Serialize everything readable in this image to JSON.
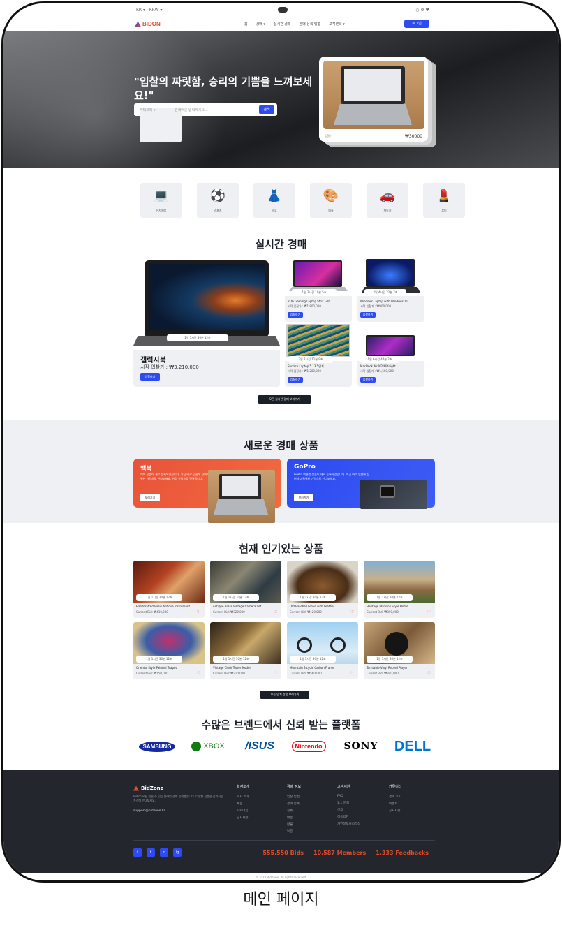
{
  "topbar": {
    "left": "KR ▾  ·  KRW ▾",
    "right": "○  ⚙  ♥"
  },
  "nav": {
    "logo": "BIDON",
    "menu": [
      "홈",
      "경매 ▾",
      "실시간 경매",
      "경매 등록 방법",
      "고객센터 ▾"
    ],
    "login": "로그인"
  },
  "hero": {
    "title": "\"입찰의 짜릿함, 승리의 기쁨을 느껴보세요!\"",
    "search_category": "카테고리 ▾",
    "search_placeholder": "검색어를 입력하세요...",
    "search_button": "검색",
    "card_price": "₩30000",
    "card_label": "입찰가"
  },
  "categories": [
    {
      "icon": "💻",
      "label": "전자제품"
    },
    {
      "icon": "⚽",
      "label": "스포츠"
    },
    {
      "icon": "👗",
      "label": "의류"
    },
    {
      "icon": "🎨",
      "label": "예술"
    },
    {
      "icon": "🚗",
      "label": "자동차"
    },
    {
      "icon": "💄",
      "label": "뷰티"
    }
  ],
  "live": {
    "title": "실시간 경매",
    "featured": {
      "name": "갤럭시북",
      "bid": "시작 입찰가 : ₩3,210,000",
      "timer": "1일 1시간 30분 12초",
      "button": "입찰하기"
    },
    "items": [
      {
        "title": "ROG Gaming Laptop Strix G16",
        "sub": "시작 입찰가 : ₩1,800,000",
        "timer": "1일 3시간 10분 5초",
        "button": "입찰하기"
      },
      {
        "title": "Windows Laptop with Windows 11",
        "sub": "시작 입찰가 : ₩900,000",
        "timer": "2일 4시간 22분 7초",
        "button": "입찰하기"
      },
      {
        "title": "Surface Laptop 5 13.5인치",
        "sub": "시작 입찰가 : ₩1,200,000",
        "timer": "3일 2시간 11분 9초",
        "button": "입찰하기"
      },
      {
        "title": "MacBook Air M2 Midnight",
        "sub": "시작 입찰가 : ₩1,500,000",
        "timer": "1일 6시간 44분 2초",
        "button": "입찰하기"
      }
    ],
    "more": "모든 실시간 경매 보러가기"
  },
  "newitems": {
    "title": "새로운 경매 상품",
    "promos": [
      {
        "name": "맥북",
        "desc": "맥북 상품이 새로 등록되었습니다. 지금 바로 입찰에 참여하고 특별한 가격으로 만나보세요. 한정 수량으로 진행됩니다.",
        "button": "보러가기"
      },
      {
        "name": "GoPro",
        "desc": "GoPro 액션캠 상품이 새로 등록되었습니다. 지금 바로 입찰에 참여하고 특별한 가격으로 만나보세요.",
        "button": "보러가기"
      }
    ]
  },
  "popular": {
    "title": "현재 인기있는 상품",
    "items": [
      {
        "title": "Handcrafted Violin Antique Instrument",
        "sub": "Current Bid: ₩430,000",
        "timer": "1일 1시간 30분 12초"
      },
      {
        "title": "Antique Brass Vintage Camera Set",
        "sub": "Current Bid: ₩320,000",
        "timer": "1일 1시간 30분 12초"
      },
      {
        "title": "Old Baseball Glove with Leather",
        "sub": "Current Bid: ₩120,000",
        "timer": "1일 1시간 30분 12초"
      },
      {
        "title": "Heritage Mansion Style Home",
        "sub": "Current Bid: ₩890,000",
        "timer": "1일 1시간 30분 12초"
      },
      {
        "title": "Oriental Style Painted Teapot",
        "sub": "Current Bid: ₩150,000",
        "timer": "1일 1시간 30분 12초"
      },
      {
        "title": "Vintage Clock Tower Model",
        "sub": "Current Bid: ₩210,000",
        "timer": "1일 1시간 30분 12초"
      },
      {
        "title": "Mountain Bicycle Carbon Frame",
        "sub": "Current Bid: ₩560,000",
        "timer": "1일 1시간 30분 12초"
      },
      {
        "title": "Turntable Vinyl Record Player",
        "sub": "Current Bid: ₩340,000",
        "timer": "1일 1시간 30분 12초"
      }
    ],
    "more": "모든 인기 상품 보러가기"
  },
  "brands": {
    "title": "수많은 브랜드에서 신뢰 받는 플랫폼",
    "names": [
      "SAMSUNG",
      "XBOX",
      "/ISUS",
      "Nintendo",
      "SONY",
      "DELL"
    ]
  },
  "footer": {
    "logo": "BidZone",
    "desc": "BidZone은 믿을 수 있는 온라인 경매 플랫폼입니다. 다양한 상품을 합리적인 가격에 만나보세요.",
    "email": "support@bidzone.kr",
    "columns": [
      {
        "title": "회사소개",
        "items": [
          "회사 소개",
          "채용",
          "파트너십",
          "공지사항"
        ]
      },
      {
        "title": "경매 정보",
        "items": [
          "입찰 방법",
          "경매 등록",
          "결제",
          "배송",
          "환불",
          "보증"
        ]
      },
      {
        "title": "고객지원",
        "items": [
          "FAQ",
          "1:1 문의",
          "신고",
          "이용약관",
          "개인정보처리방침"
        ]
      },
      {
        "title": "커뮤니티",
        "items": [
          "경매 후기",
          "이벤트",
          "공지사항"
        ]
      }
    ],
    "social": [
      "f",
      "t",
      "in",
      "ig"
    ],
    "stats": [
      "555,550 Bids",
      "10,587 Members",
      "1,333 Feedbacks"
    ],
    "copyright": "© 2024 BidZone. All rights reserved."
  },
  "caption": "메인 페이지"
}
